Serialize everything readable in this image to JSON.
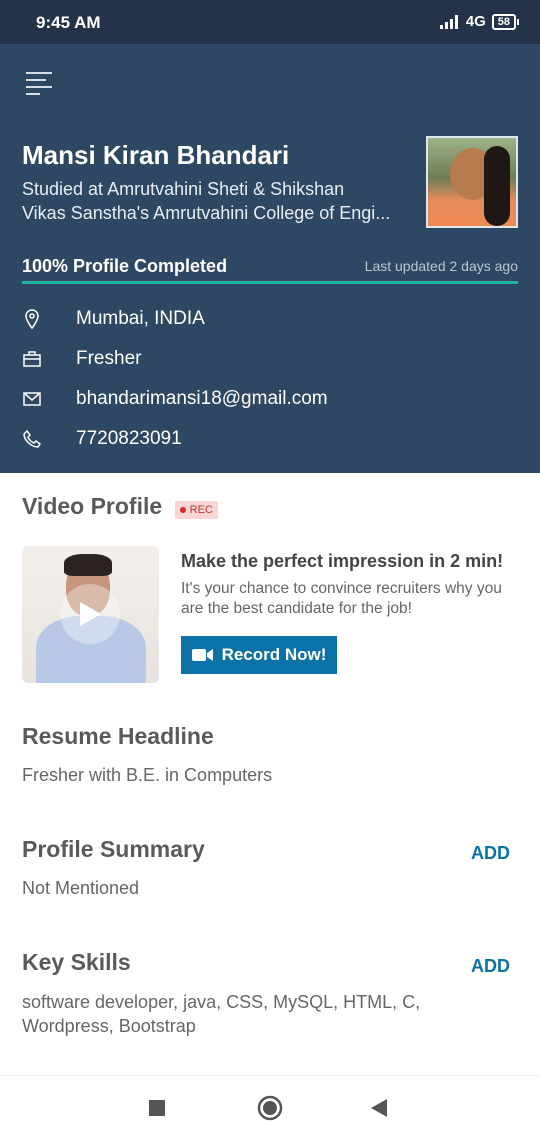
{
  "status_bar": {
    "time": "9:45 AM",
    "network": "4G",
    "battery": "58"
  },
  "header": {
    "name": "Mansi Kiran Bhandari",
    "education_line1": "Studied at Amrutvahini Sheti & Shikshan",
    "education_line2": "Vikas Sanstha's Amrutvahini College of Engi...",
    "completion_text": "100% Profile Completed",
    "completion_fraction": 1.0,
    "last_updated": "Last updated 2 days ago",
    "location": "Mumbai, INDIA",
    "experience": "Fresher",
    "email": "bhandarimansi18@gmail.com",
    "phone": "7720823091"
  },
  "video_profile": {
    "title": "Video Profile",
    "badge": "REC",
    "headline": "Make the perfect impression in 2 min!",
    "description": "It's your chance to convince recruiters why you are the best candidate for the job!",
    "button_label": "Record Now!"
  },
  "resume_headline": {
    "title": "Resume Headline",
    "text": "Fresher with B.E. in Computers"
  },
  "profile_summary": {
    "title": "Profile Summary",
    "action": "ADD",
    "text": "Not Mentioned"
  },
  "key_skills": {
    "title": "Key Skills",
    "action": "ADD",
    "text": "software developer, java, CSS, MySQL, HTML, C, Wordpress, Bootstrap"
  },
  "colors": {
    "header_bg": "#2e4762",
    "status_bg": "#22334a",
    "accent": "#0b72a8",
    "progress": "#24b39b"
  }
}
